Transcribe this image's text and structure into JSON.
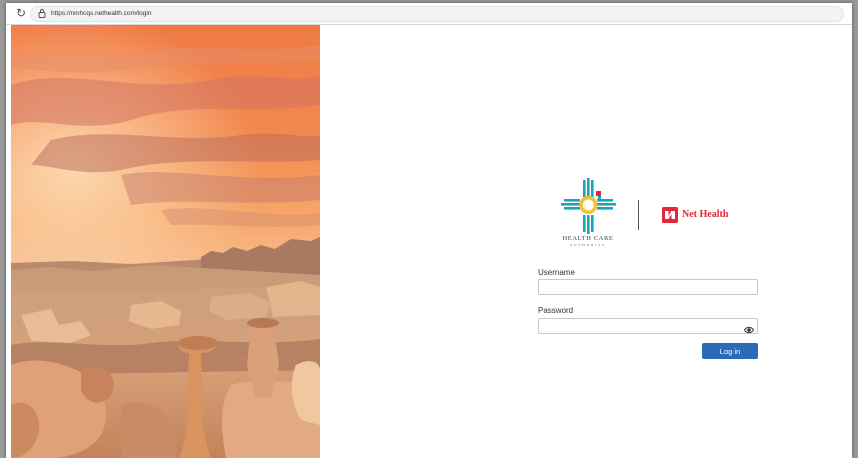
{
  "browser": {
    "url": "https://nmhcqs.nethealth.com/login",
    "reload_glyph": "↻",
    "lock_glyph": "⌂"
  },
  "photo": {
    "icon": "landscape-photo"
  },
  "branding": {
    "hca_line1": "HEALTH CARE",
    "hca_line2": "AUTHORITY",
    "nethealth_name": "Net Health",
    "colors": {
      "zia_teal": "#1aa5b8",
      "zia_yellow": "#f2c12e",
      "nethealth_red": "#e0283a"
    }
  },
  "form": {
    "username_label": "Username",
    "username_value": "",
    "password_label": "Password",
    "password_value": "",
    "login_label": "Log in",
    "button_color": "#2a6bb8"
  }
}
